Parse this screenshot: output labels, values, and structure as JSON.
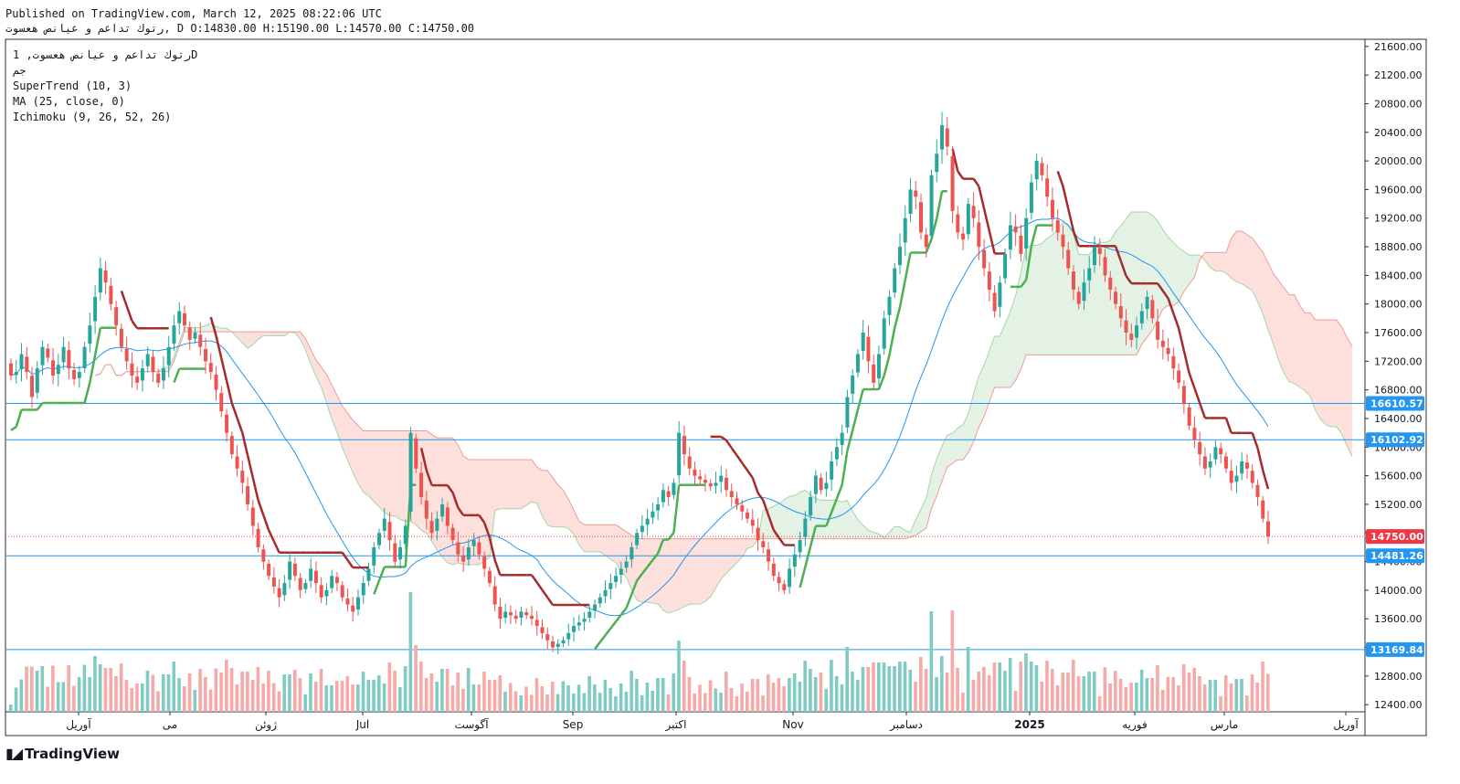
{
  "header": {
    "published": "Published on TradingView.com, March 12, 2025 08:22:06 UTC",
    "symbol_line": "رتوك تداعم و عيانص هعسوت, D",
    "ohlc": {
      "o": "O:14830.00",
      "h": "H:15190.00",
      "l": "L:14570.00",
      "c": "C:14750.00"
    }
  },
  "legend": {
    "symbol": "رتوك تداعم و عيانص هعسوت, 1D",
    "exchange": "جم",
    "indicators": [
      "SuperTrend (10, 3)",
      "MA (25, close, 0)",
      "Ichimoku (9, 26, 52, 26)"
    ]
  },
  "brand": {
    "text": "TradingView",
    "logo": "tradingview-logo-icon"
  },
  "colors": {
    "up": "#26a69a",
    "down": "#ef5350",
    "st_up": "#4caf50",
    "st_down": "#a52a2a",
    "ma": "#2196f3",
    "hline": "#2196f3",
    "cloud_red": "#fde0dc",
    "cloud_green": "#e3f2e5",
    "last_price": "#f23645"
  },
  "chart_data": {
    "type": "candlestick",
    "y_ticks": [
      "21600.00",
      "21200.00",
      "20800.00",
      "20400.00",
      "20000.00",
      "19600.00",
      "19200.00",
      "18800.00",
      "18400.00",
      "18000.00",
      "17600.00",
      "17200.00",
      "16800.00",
      "16400.00",
      "16000.00",
      "15600.00",
      "15200.00",
      "14800.00",
      "14400.00",
      "14000.00",
      "13600.00",
      "13200.00",
      "12800.00",
      "12400.00"
    ],
    "ylim": [
      12300,
      21700
    ],
    "x_labels": [
      "آوریل",
      "می",
      "ژوئن",
      "Jul",
      "آگوست",
      "Sep",
      "اکتبر",
      "Nov",
      "دسامبر",
      "2025",
      "فوریه",
      "مارس",
      "آوریل"
    ],
    "price_lines": [
      "16610.57",
      "16102.92",
      "14481.26",
      "13169.84"
    ],
    "last_price": "14750.00",
    "ohlc": {
      "open": 14830,
      "high": 15190,
      "low": 14570,
      "close": 14750
    },
    "series": [
      {
        "kind": "candles",
        "close": [
          17000,
          17050,
          17300,
          17050,
          16700,
          17100,
          17400,
          17250,
          17000,
          17150,
          17400,
          17100,
          16950,
          17050,
          17400,
          17700,
          18100,
          18500,
          18300,
          18000,
          17700,
          17400,
          17200,
          17000,
          16900,
          17100,
          17300,
          17050,
          16900,
          17100,
          17400,
          17700,
          17900,
          17700,
          17500,
          17600,
          17400,
          17200,
          17050,
          16800,
          16500,
          16200,
          15900,
          15700,
          15500,
          15200,
          14900,
          14600,
          14400,
          14200,
          14050,
          13900,
          14100,
          14400,
          14200,
          14000,
          14100,
          14300,
          14100,
          13900,
          14000,
          14200,
          14100,
          13900,
          13800,
          13700,
          13900,
          14100,
          14300,
          14600,
          14800,
          15000,
          14700,
          14400,
          14600,
          14900,
          16200,
          15700,
          15300,
          15000,
          14800,
          15000,
          15200,
          14900,
          14700,
          14500,
          14400,
          14600,
          14700,
          14500,
          14300,
          14100,
          13800,
          13600,
          13700,
          13650,
          13600,
          13700,
          13650,
          13600,
          13500,
          13400,
          13300,
          13200,
          13250,
          13300,
          13400,
          13500,
          13550,
          13600,
          13700,
          13800,
          13900,
          14000,
          14100,
          14200,
          14300,
          14400,
          14600,
          14800,
          14900,
          15000,
          15100,
          15200,
          15400,
          15300,
          15500,
          16200,
          15900,
          15700,
          15600,
          15550,
          15500,
          15450,
          15500,
          15600,
          15400,
          15300,
          15200,
          15100,
          15000,
          14900,
          14700,
          14600,
          14400,
          14200,
          14100,
          14000,
          14300,
          14500,
          14700,
          15000,
          15300,
          15600,
          15400,
          15500,
          15800,
          16000,
          16200,
          16700,
          17000,
          17300,
          17600,
          17200,
          16900,
          17300,
          17800,
          18100,
          18500,
          18800,
          19200,
          19600,
          19500,
          19000,
          18800,
          19800,
          20100,
          20500,
          20200,
          19300,
          19000,
          18900,
          19400,
          19200,
          18800,
          18500,
          18200,
          17900,
          18300,
          18700,
          19100,
          19000,
          18700,
          19200,
          19700,
          20000,
          19800,
          19500,
          19200,
          19000,
          18800,
          18500,
          18200,
          18000,
          18300,
          18500,
          18800,
          18700,
          18400,
          18200,
          18000,
          17800,
          17600,
          17500,
          17700,
          17900,
          18100,
          17800,
          17500,
          17400,
          17300,
          17100,
          16900,
          16600,
          16300,
          16100,
          15900,
          15700,
          15800,
          16000,
          15900,
          15700,
          15500,
          15600,
          15800,
          15700,
          15500,
          15300,
          15000,
          14750
        ]
      },
      {
        "kind": "volume",
        "note": "histogram at bottom of price pane"
      },
      {
        "name": "SuperTrend (10, 3)"
      },
      {
        "name": "MA (25, close, 0)"
      },
      {
        "name": "Ichimoku (9, 26, 52, 26)"
      }
    ]
  }
}
